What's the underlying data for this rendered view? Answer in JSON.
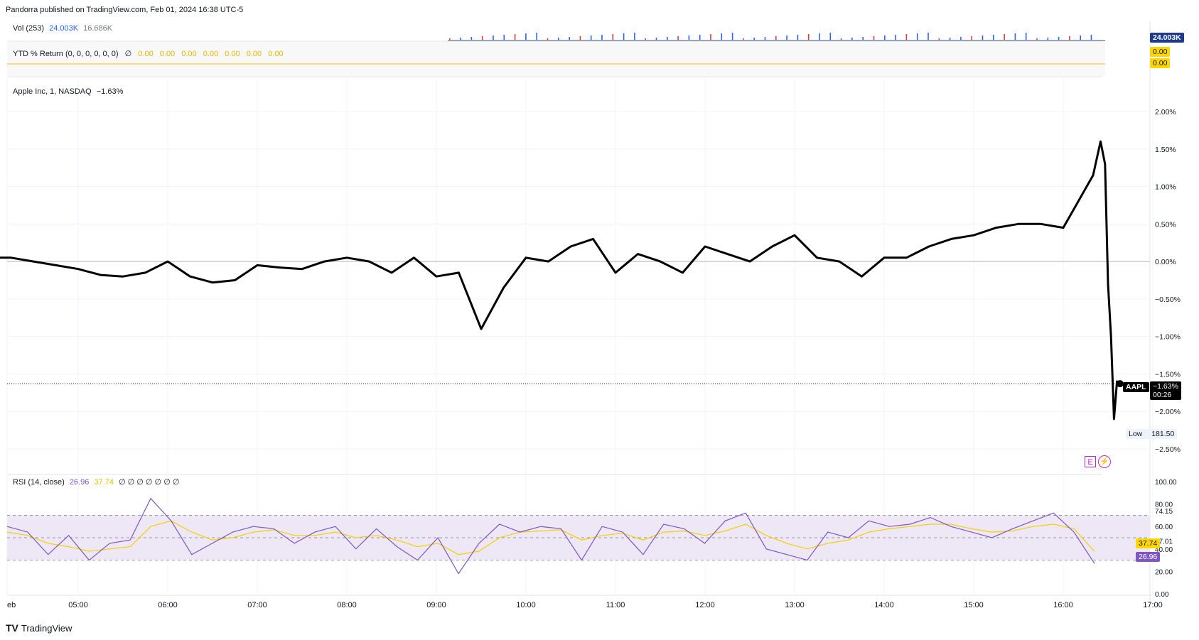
{
  "header": {
    "published": "Pandorra published on TradingView.com, Feb 01, 2024 16:38 UTC-5"
  },
  "volume_panel": {
    "label": "Vol (253)",
    "value_primary": "24.003K",
    "value_secondary": "16.686K",
    "axis_badge": "24.003K",
    "colors": {
      "up": "#2962ff",
      "down": "#e53935",
      "badge_bg": "#1e3a8a"
    }
  },
  "ytd_panel": {
    "label": "YTD % Return (0, 0, 0, 0, 0, 0)",
    "sym": "∅",
    "values": [
      "0.00",
      "0.00",
      "0.00",
      "0.00",
      "0.00",
      "0.00",
      "0.00"
    ],
    "axis_badges": [
      "0.00",
      "0.00"
    ],
    "color": "#f5c000"
  },
  "price_panel": {
    "label": "Apple Inc, 1, NASDAQ",
    "change": "−1.63%",
    "y_ticks": [
      "2.00%",
      "1.50%",
      "1.00%",
      "0.50%",
      "0.00%",
      "−0.50%",
      "−1.00%",
      "−1.50%",
      "−2.00%",
      "−2.50%"
    ],
    "symbol_badge": "AAPL",
    "last_badge": "−1.63%",
    "timer": "00:26",
    "low_label": "Low",
    "low_value": "181.50",
    "event_icons": [
      "E",
      "⚡"
    ]
  },
  "rsi_panel": {
    "label": "RSI (14, close)",
    "rsi_value": "26.96",
    "ma_value": "37.74",
    "syms": "∅ ∅ ∅ ∅ ∅ ∅ ∅",
    "y_ticks": [
      "100.00",
      "80.00",
      "74.15",
      "60.00",
      "47.01",
      "40.00",
      "20.00",
      "0.00"
    ],
    "badge_ma": "37.74",
    "badge_rsi": "26.96",
    "colors": {
      "rsi": "#7e57c2",
      "ma": "#f5d000",
      "band": "#ede7f6"
    }
  },
  "x_axis": {
    "labels": [
      "eb",
      "05:00",
      "06:00",
      "07:00",
      "08:00",
      "09:00",
      "10:00",
      "11:00",
      "12:00",
      "13:00",
      "14:00",
      "15:00",
      "16:00",
      "17:00"
    ]
  },
  "footer": {
    "brand": "TradingView",
    "logo": "TV"
  },
  "chart_data": {
    "type": "line",
    "title": "Apple Inc, 1, NASDAQ",
    "ylim": [
      -2.5,
      2.0
    ],
    "x": [
      "04:00",
      "04:15",
      "04:30",
      "04:45",
      "05:00",
      "05:15",
      "05:30",
      "05:45",
      "06:00",
      "06:15",
      "06:30",
      "06:45",
      "07:00",
      "07:15",
      "07:30",
      "07:45",
      "08:00",
      "08:15",
      "08:30",
      "08:45",
      "09:00",
      "09:15",
      "09:30",
      "09:45",
      "10:00",
      "10:15",
      "10:30",
      "10:45",
      "11:00",
      "11:15",
      "11:30",
      "11:45",
      "12:00",
      "12:15",
      "12:30",
      "12:45",
      "13:00",
      "13:15",
      "13:30",
      "13:45",
      "14:00",
      "14:15",
      "14:30",
      "14:45",
      "15:00",
      "15:15",
      "15:30",
      "15:45",
      "16:00",
      "16:10",
      "16:20",
      "16:25",
      "16:28",
      "16:30",
      "16:32",
      "16:34",
      "16:36",
      "16:38"
    ],
    "series": [
      {
        "values": [
          0.05,
          0.05,
          0.0,
          -0.05,
          -0.1,
          -0.18,
          -0.2,
          -0.15,
          0.0,
          -0.2,
          -0.28,
          -0.25,
          -0.05,
          -0.08,
          -0.1,
          0.0,
          0.05,
          0.0,
          -0.15,
          0.05,
          -0.2,
          -0.15,
          -0.9,
          -0.35,
          0.05,
          0.0,
          0.2,
          0.3,
          -0.15,
          0.1,
          0.0,
          -0.15,
          0.2,
          0.1,
          0.0,
          0.2,
          0.35,
          0.05,
          0.0,
          -0.2,
          0.05,
          0.05,
          0.2,
          0.3,
          0.35,
          0.45,
          0.5,
          0.5,
          0.45,
          0.8,
          1.15,
          1.6,
          1.3,
          -0.3,
          -1.0,
          -2.1,
          -1.6,
          -1.63
        ]
      }
    ],
    "rsi": {
      "ylim": [
        0,
        100
      ],
      "bands": [
        30,
        50,
        70
      ],
      "rsi_values": [
        60,
        55,
        35,
        52,
        30,
        45,
        48,
        85,
        65,
        35,
        45,
        55,
        60,
        58,
        45,
        55,
        60,
        40,
        58,
        42,
        30,
        50,
        18,
        45,
        62,
        55,
        60,
        58,
        30,
        60,
        55,
        35,
        62,
        58,
        45,
        65,
        72,
        40,
        35,
        30,
        55,
        50,
        65,
        60,
        62,
        68,
        60,
        55,
        50,
        58,
        65,
        72,
        55,
        26.96
      ],
      "ma_values": [
        55,
        52,
        45,
        42,
        38,
        40,
        42,
        60,
        65,
        55,
        48,
        50,
        55,
        57,
        52,
        52,
        55,
        50,
        52,
        48,
        42,
        45,
        35,
        38,
        50,
        55,
        56,
        57,
        48,
        52,
        54,
        48,
        55,
        56,
        52,
        56,
        62,
        52,
        45,
        40,
        45,
        48,
        55,
        58,
        60,
        62,
        62,
        58,
        55,
        56,
        60,
        62,
        58,
        37.74
      ]
    }
  }
}
